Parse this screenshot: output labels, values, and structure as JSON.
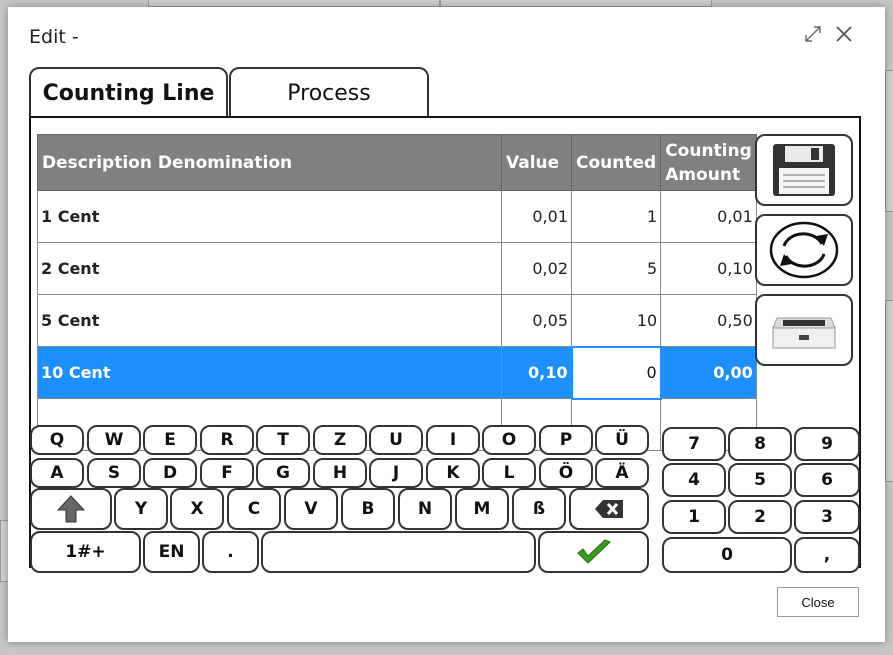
{
  "dialog": {
    "title": "Edit -",
    "close_label": "Close"
  },
  "tabs": [
    {
      "label": "Counting Line"
    },
    {
      "label": "Process"
    }
  ],
  "table": {
    "headers": [
      "Description Denomination",
      "Value",
      "Counted",
      "Counting Amount"
    ],
    "rows": [
      {
        "desc": "1 Cent",
        "value": "0,01",
        "counted": "1",
        "amount": "0,01"
      },
      {
        "desc": "2 Cent",
        "value": "0,02",
        "counted": "5",
        "amount": "0,10"
      },
      {
        "desc": "5 Cent",
        "value": "0,05",
        "counted": "10",
        "amount": "0,50"
      },
      {
        "desc": "10 Cent",
        "value": "0,10",
        "counted": "0",
        "amount": "0,00"
      }
    ]
  },
  "keyboard": {
    "row1": [
      "Q",
      "W",
      "E",
      "R",
      "T",
      "Z",
      "U",
      "I",
      "O",
      "P",
      "Ü"
    ],
    "row2": [
      "A",
      "S",
      "D",
      "F",
      "G",
      "H",
      "J",
      "K",
      "L",
      "Ö",
      "Ä"
    ],
    "row3": [
      "Y",
      "X",
      "C",
      "V",
      "B",
      "N",
      "M",
      "ß"
    ],
    "row4": {
      "symbols": "1#+",
      "lang": "EN",
      "dot": "."
    },
    "numpad": [
      "7",
      "8",
      "9",
      "4",
      "5",
      "6",
      "1",
      "2",
      "3"
    ],
    "zero": "0",
    "comma": ","
  },
  "colors": {
    "selected_row": "#1e8fff",
    "header_bg": "#808080",
    "confirm_check": "#3a9a1a"
  },
  "icons": [
    "floppy-disk-icon",
    "refresh-circle-icon",
    "cash-drawer-icon",
    "shift-arrow-icon",
    "backspace-icon",
    "checkmark-icon",
    "expand-icon",
    "close-icon"
  ]
}
